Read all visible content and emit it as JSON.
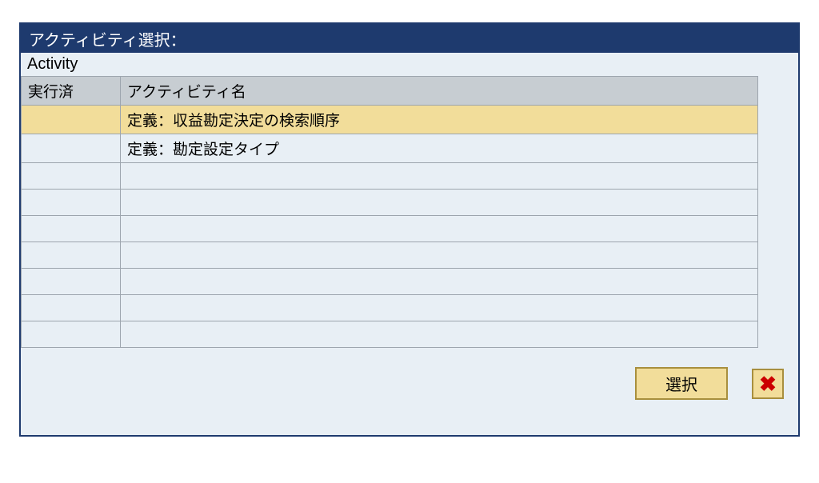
{
  "title": "アクティビティ選択：",
  "subtitle": "Activity",
  "columns": {
    "executed": "実行済",
    "activity_name": "アクティビティ名"
  },
  "rows": [
    {
      "executed": "",
      "activity_name": "定義：収益勘定決定の検索順序",
      "selected": true
    },
    {
      "executed": "",
      "activity_name": "定義：勘定設定タイプ",
      "selected": false
    },
    {
      "executed": "",
      "activity_name": "",
      "selected": false
    },
    {
      "executed": "",
      "activity_name": "",
      "selected": false
    },
    {
      "executed": "",
      "activity_name": "",
      "selected": false
    },
    {
      "executed": "",
      "activity_name": "",
      "selected": false
    },
    {
      "executed": "",
      "activity_name": "",
      "selected": false
    },
    {
      "executed": "",
      "activity_name": "",
      "selected": false
    },
    {
      "executed": "",
      "activity_name": "",
      "selected": false
    }
  ],
  "buttons": {
    "select": "選択"
  }
}
